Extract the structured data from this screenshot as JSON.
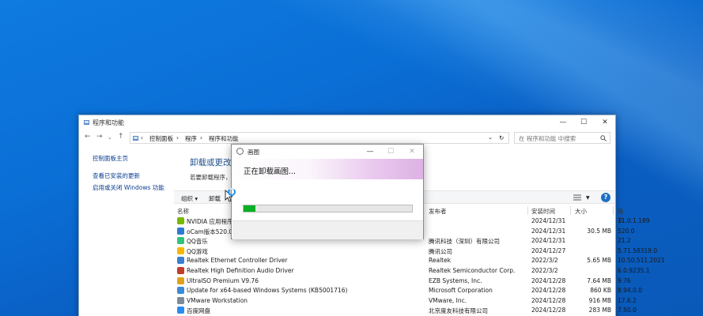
{
  "window": {
    "title": "程序和功能",
    "controls": {
      "minimize": "—",
      "maximize": "☐",
      "close": "✕"
    }
  },
  "address": {
    "breadcrumb": [
      "控制面板",
      "程序",
      "程序和功能"
    ],
    "separator": "›",
    "search_placeholder": "在 程序和功能 中搜索"
  },
  "sidebar": {
    "items": [
      "控制面板主页",
      "查看已安装的更新",
      "启用或关闭 Windows 功能"
    ]
  },
  "content": {
    "heading": "卸载或更改程序",
    "heading_visible": "卸载或更改程",
    "subtext": "若要卸载程序，",
    "toolbar": {
      "organize": "组织 ▾",
      "uninstall": "卸载"
    },
    "columns": [
      "名称",
      "发布者",
      "安装时间",
      "大小",
      "版本"
    ],
    "rows": [
      {
        "name": "NVIDIA 应用程序",
        "publisher": "",
        "date": "2024/12/31",
        "size": "",
        "version": "11.0.1.189",
        "color": "#76b900"
      },
      {
        "name": "oCam版本520.0",
        "publisher": "",
        "date": "2024/12/31",
        "size": "30.5 MB",
        "version": "520.0",
        "color": "#2b7bd6"
      },
      {
        "name": "QQ音乐",
        "publisher": "腾讯科技（深圳）有限公司",
        "date": "2024/12/31",
        "size": "",
        "version": "21.2",
        "color": "#31c27c"
      },
      {
        "name": "QQ游戏",
        "publisher": "腾讯公司",
        "date": "2024/12/27",
        "size": "",
        "version": "5.71.58319.0",
        "color": "#f5b800"
      },
      {
        "name": "Realtek Ethernet Controller Driver",
        "publisher": "Realtek",
        "date": "2022/3/2",
        "size": "5.65 MB",
        "version": "10.50.511.2021",
        "color": "#3a7fd1"
      },
      {
        "name": "Realtek High Definition Audio Driver",
        "publisher": "Realtek Semiconductor Corp.",
        "date": "2022/3/2",
        "size": "",
        "version": "6.0.9235.1",
        "color": "#c33c2a"
      },
      {
        "name": "UltraISO Premium V9.76",
        "publisher": "EZB Systems, Inc.",
        "date": "2024/12/28",
        "size": "7.64 MB",
        "version": "9.76",
        "color": "#e0a21b"
      },
      {
        "name": "Update for x64-based Windows Systems (KB5001716)",
        "publisher": "Microsoft Corporation",
        "date": "2024/12/28",
        "size": "860 KB",
        "version": "8.94.0.0",
        "color": "#3b8ad8"
      },
      {
        "name": "VMware Workstation",
        "publisher": "VMware, Inc.",
        "date": "2024/12/28",
        "size": "916 MB",
        "version": "17.6.2",
        "color": "#7b8b9a"
      },
      {
        "name": "百度网盘",
        "publisher": "北京度友科技有限公司",
        "date": "2024/12/28",
        "size": "283 MB",
        "version": "7.50.0",
        "color": "#2a8cf0"
      }
    ]
  },
  "dialog": {
    "title": "画图",
    "message": "正在卸载画图...",
    "progress": 0.07,
    "controls": {
      "minimize": "—",
      "maximize": "☐",
      "close": "✕"
    }
  },
  "colors": {
    "desktop": "#0a63c9",
    "progress_fill": "#06b025",
    "link": "#0b3d91"
  }
}
